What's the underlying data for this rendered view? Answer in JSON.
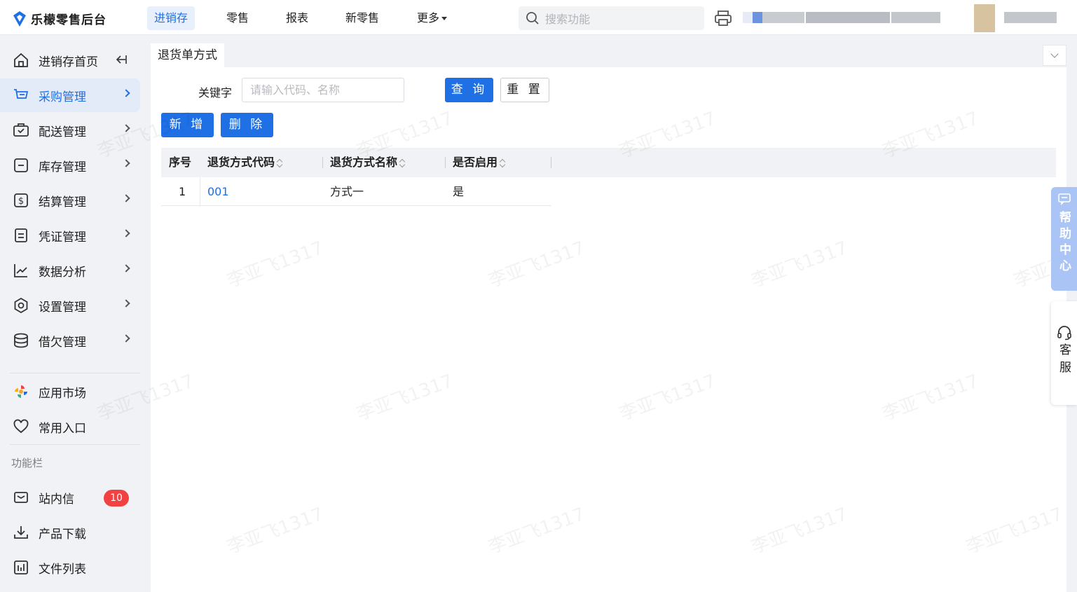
{
  "app": {
    "title": "乐檬零售后台"
  },
  "topnav": [
    {
      "label": "进销存",
      "active": true
    },
    {
      "label": "零售"
    },
    {
      "label": "报表"
    },
    {
      "label": "新零售"
    },
    {
      "label": "更多"
    }
  ],
  "search": {
    "placeholder": "搜索功能"
  },
  "sidebar": {
    "items": [
      {
        "label": "进销存首页",
        "icon": "home-icon"
      },
      {
        "label": "采购管理",
        "icon": "cart-icon",
        "active": true
      },
      {
        "label": "配送管理",
        "icon": "delivery-icon"
      },
      {
        "label": "库存管理",
        "icon": "inventory-icon"
      },
      {
        "label": "结算管理",
        "icon": "settlement-icon"
      },
      {
        "label": "凭证管理",
        "icon": "voucher-icon"
      },
      {
        "label": "数据分析",
        "icon": "chart-icon"
      },
      {
        "label": "设置管理",
        "icon": "settings-icon"
      },
      {
        "label": "借欠管理",
        "icon": "coins-icon"
      }
    ],
    "extras": [
      {
        "label": "应用市场",
        "icon": "app-market-icon"
      },
      {
        "label": "常用入口",
        "icon": "heart-icon"
      }
    ],
    "section_title": "功能栏",
    "tools": [
      {
        "label": "站内信",
        "icon": "mail-icon",
        "badge": "10"
      },
      {
        "label": "产品下载",
        "icon": "download-icon"
      },
      {
        "label": "文件列表",
        "icon": "file-list-icon"
      }
    ]
  },
  "tabs": [
    {
      "label": "退货单方式"
    }
  ],
  "filter": {
    "keyword_label": "关键字",
    "keyword_placeholder": "请输入代码、名称",
    "query_label": "查 询",
    "reset_label": "重 置"
  },
  "actions": {
    "add_label": "新 增",
    "delete_label": "删 除"
  },
  "table": {
    "headers": [
      "序号",
      "退货方式代码",
      "退货方式名称",
      "是否启用"
    ],
    "rows": [
      {
        "index": "1",
        "code": "001",
        "name": "方式一",
        "enabled": "是"
      }
    ]
  },
  "float": {
    "help_label": "帮助中心",
    "service_label": "客服"
  },
  "watermark": "李亚飞1317",
  "colors": {
    "primary": "#1f6fe5",
    "badge": "#f24141",
    "help_bg": "#a9c4f5"
  }
}
